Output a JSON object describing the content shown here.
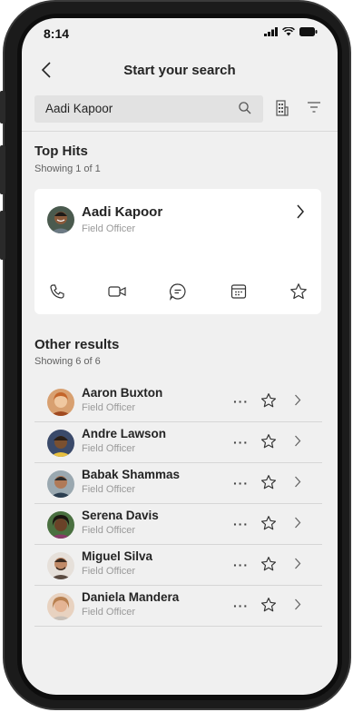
{
  "status": {
    "time": "8:14"
  },
  "nav": {
    "title": "Start your search"
  },
  "search": {
    "value": "Aadi Kapoor"
  },
  "top_hits": {
    "title": "Top Hits",
    "showing": "Showing 1 of 1",
    "person": {
      "name": "Aadi Kapoor",
      "role": "Field Officer"
    },
    "actions": [
      "call-icon",
      "video-icon",
      "chat-icon",
      "calendar-icon",
      "favorite-star-icon"
    ]
  },
  "other_results": {
    "title": "Other results",
    "showing": "Showing 6 of 6",
    "items": [
      {
        "name": "Aaron Buxton",
        "role": "Field Officer"
      },
      {
        "name": "Andre Lawson",
        "role": "Field Officer"
      },
      {
        "name": "Babak Shammas",
        "role": "Field Officer"
      },
      {
        "name": "Serena Davis",
        "role": "Field Officer"
      },
      {
        "name": "Miguel Silva",
        "role": "Field Officer"
      },
      {
        "name": "Daniela Mandera",
        "role": "Field Officer"
      }
    ]
  },
  "row_more_label": "···",
  "colors": {
    "screen_bg": "#f0f0f0",
    "card_bg": "#ffffff",
    "text": "#242424",
    "secondary": "#9a9a9a"
  }
}
